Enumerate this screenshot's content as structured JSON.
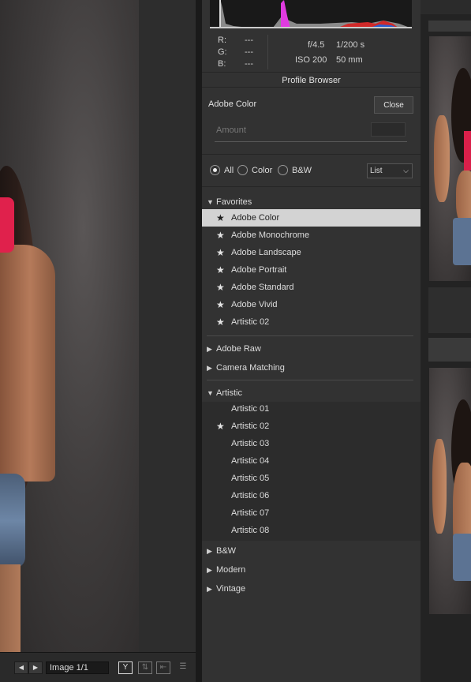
{
  "info": {
    "rgb_labels": [
      "R:",
      "G:",
      "B:"
    ],
    "rgb_values": [
      "---",
      "---",
      "---"
    ],
    "aperture": "f/4.5",
    "shutter": "1/200 s",
    "iso": "ISO 200",
    "focal": "50 mm"
  },
  "profile_browser": {
    "title": "Profile Browser",
    "current_profile": "Adobe Color",
    "close_label": "Close",
    "amount_label": "Amount",
    "amount_value": "",
    "filters": [
      "All",
      "Color",
      "B&W"
    ],
    "selected_filter": "All",
    "view_mode": "List"
  },
  "groups": {
    "favorites": {
      "label": "Favorites",
      "items": [
        "Adobe Color",
        "Adobe Monochrome",
        "Adobe Landscape",
        "Adobe Portrait",
        "Adobe Standard",
        "Adobe Vivid",
        "Artistic 02"
      ]
    },
    "adobe_raw": {
      "label": "Adobe Raw"
    },
    "camera_matching": {
      "label": "Camera Matching"
    },
    "artistic": {
      "label": "Artistic",
      "items": [
        "Artistic 01",
        "Artistic 02",
        "Artistic 03",
        "Artistic 04",
        "Artistic 05",
        "Artistic 06",
        "Artistic 07",
        "Artistic 08"
      ]
    },
    "bw": {
      "label": "B&W"
    },
    "modern": {
      "label": "Modern"
    },
    "vintage": {
      "label": "Vintage"
    }
  },
  "bottom_bar": {
    "image_counter": "Image 1/1",
    "icons": [
      "prev-arrow-icon",
      "next-arrow-icon",
      "before-after-icon",
      "swap-icon",
      "copy-settings-icon",
      "settings-icon"
    ]
  },
  "colors": {
    "panel_bg": "#323232",
    "selected_row": "#d3d3d3",
    "accent_pink": "#e0214c"
  }
}
